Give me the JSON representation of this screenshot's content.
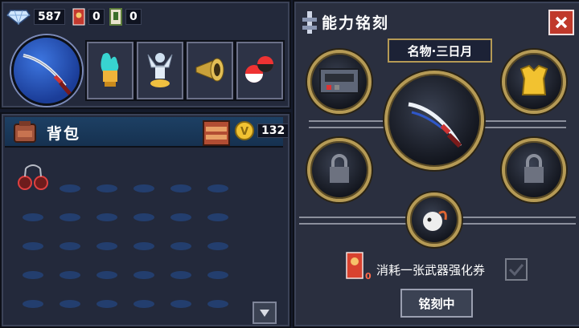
{
  "resources": {
    "gems": "587",
    "tickets_red": "0",
    "tickets_white": "0"
  },
  "backpack": {
    "title": "背包",
    "coins": "132"
  },
  "engrave": {
    "title": "能力铭刻",
    "weapon_name": "名物·三日月",
    "consume_label": "消耗一张武器强化券",
    "coupon_count": "0",
    "action_label": "铭刻中"
  },
  "colors": {
    "accent_gold": "#b59a55",
    "panel": "#23293b",
    "header_blue": "#1d4064",
    "close_red": "#c0392b"
  }
}
